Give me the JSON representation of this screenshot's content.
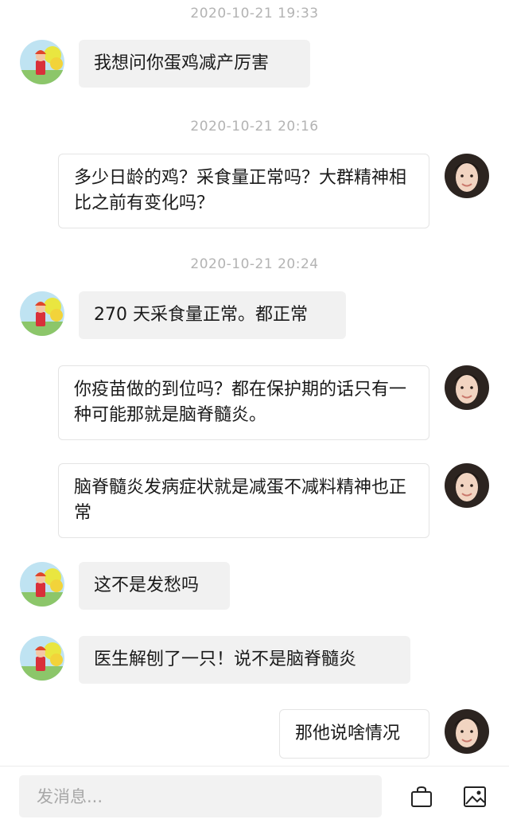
{
  "messages": [
    {
      "timestamp": "2020-10-21 19:33",
      "sender": "customer",
      "text": "我想问你蛋鸡减产厉害"
    },
    {
      "timestamp": "2020-10-21 20:16",
      "sender": "vet",
      "text": "多少日龄的鸡？采食量正常吗？大群精神相比之前有变化吗？"
    },
    {
      "timestamp": "2020-10-21 20:24",
      "sender": "customer",
      "text": "270 天采食量正常。都正常"
    },
    {
      "sender": "vet",
      "text": "你疫苗做的到位吗？都在保护期的话只有一种可能那就是脑脊髓炎。"
    },
    {
      "sender": "vet",
      "text": "脑脊髓炎发病症状就是减蛋不减料精神也正常"
    },
    {
      "sender": "customer",
      "text": "这不是发愁吗"
    },
    {
      "sender": "customer",
      "text": "医生解刨了一只！说不是脑脊髓炎"
    },
    {
      "sender": "vet",
      "text": "那他说啥情况"
    }
  ],
  "composer": {
    "placeholder": "发消息..."
  },
  "icons": {
    "shop": "shopping-bag-icon",
    "image": "image-icon"
  }
}
